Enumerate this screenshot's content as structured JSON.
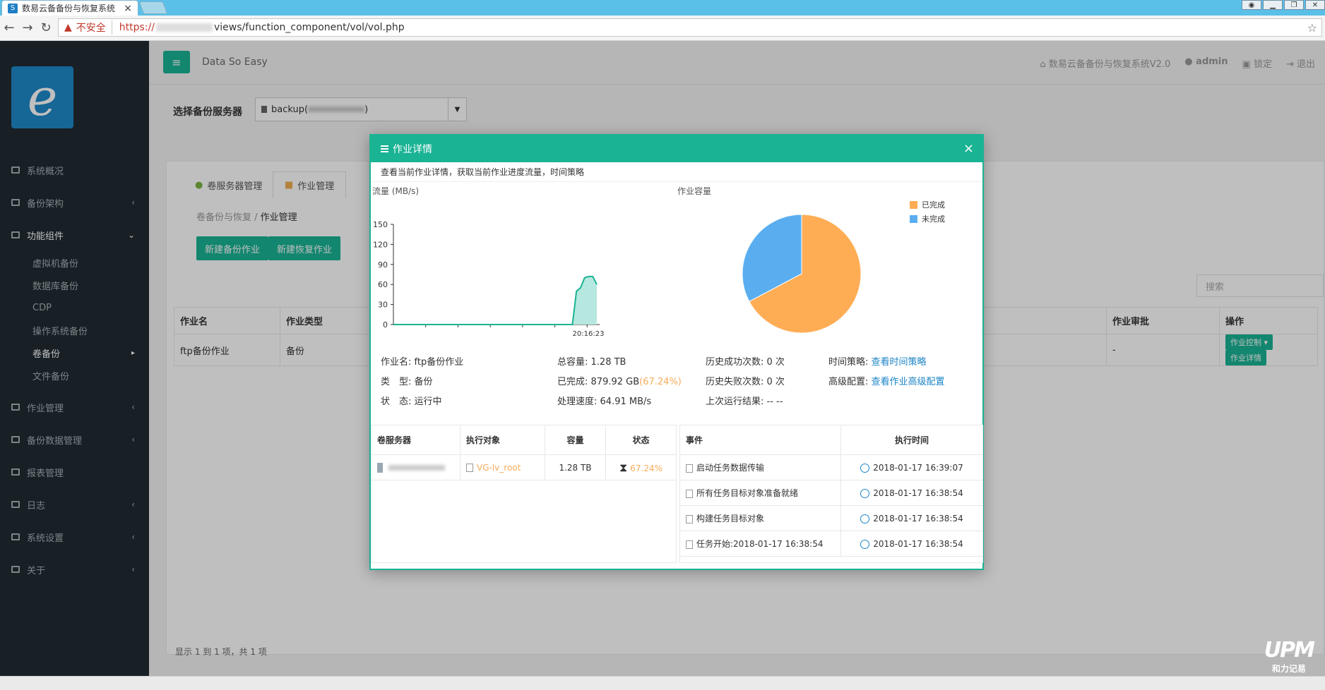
{
  "browser": {
    "tab_title": "数易云备备份与恢复系统",
    "tab_close": "×",
    "insecure_label": "不安全",
    "url_scheme": "https://",
    "url_path": "views/function_component/vol/vol.php"
  },
  "sidebar": {
    "items": [
      {
        "label": "系统概况",
        "chevron": ""
      },
      {
        "label": "备份架构",
        "chevron": "‹"
      },
      {
        "label": "功能组件",
        "chevron": "⌄"
      }
    ],
    "sub_items": [
      {
        "label": "虚拟机备份"
      },
      {
        "label": "数据库备份"
      },
      {
        "label": "CDP"
      },
      {
        "label": "操作系统备份"
      },
      {
        "label": "卷备份",
        "chevron": "▸"
      },
      {
        "label": "文件备份"
      }
    ],
    "items_after": [
      {
        "label": "作业管理",
        "chevron": "‹"
      },
      {
        "label": "备份数据管理",
        "chevron": "‹"
      },
      {
        "label": "报表管理",
        "chevron": ""
      },
      {
        "label": "日志",
        "chevron": "‹"
      },
      {
        "label": "系统设置",
        "chevron": "‹"
      },
      {
        "label": "关于",
        "chevron": "‹"
      }
    ]
  },
  "header": {
    "brand": "Data So Easy",
    "system_name": "数易云备备份与恢复系统V2.0",
    "user": "admin",
    "lock": "锁定",
    "logout": "退出"
  },
  "main": {
    "select_label": "选择备份服务器",
    "select_value": "backup(",
    "select_value_end": ")",
    "tabs": [
      "卷服务器管理",
      "作业管理"
    ],
    "breadcrumb": {
      "parent": "卷备份与恢复 /",
      "current": "作业管理"
    },
    "buttons": [
      "新建备份作业",
      "新建恢复作业"
    ],
    "search_placeholder": "搜索",
    "table": {
      "headers": [
        "作业名",
        "作业类型",
        "",
        "作业审批",
        "操作"
      ],
      "row": {
        "name": "ftp备份作业",
        "type": "备份",
        "approval": "-",
        "btn_control": "作业控制 ▾",
        "btn_detail": "作业详情"
      }
    },
    "footer": "显示 1 到 1 项，共 1 项"
  },
  "modal": {
    "title": "作业详情",
    "close": "×",
    "subtitle": "查看当前作业详情，获取当前作业进度流量，时间策略",
    "flow_label": "流量 (MB/s)",
    "capacity_label": "作业容量",
    "info": {
      "job_name_k": "作业名:",
      "job_name_v": "ftp备份作业",
      "type_k": "类　型:",
      "type_v": "备份",
      "status_k": "状　态:",
      "status_v": "运行中",
      "total_k": "总容量:",
      "total_v": "1.28 TB",
      "done_k": "已完成:",
      "done_v": "879.92 GB",
      "done_pct": "(67.24%)",
      "speed_k": "处理速度:",
      "speed_v": "64.91 MB/s",
      "succ_k": "历史成功次数:",
      "succ_v": "0 次",
      "fail_k": "历史失败次数:",
      "fail_v": "0 次",
      "last_k": "上次运行结果:",
      "last_v": "-- --",
      "policy_k": "时间策略:",
      "policy_v": "查看时间策略",
      "adv_k": "高级配置:",
      "adv_v": "查看作业高级配置"
    },
    "left_table": {
      "headers": [
        "卷服务器",
        "执行对象",
        "容量",
        "状态"
      ],
      "row": {
        "object": "VG-lv_root",
        "capacity": "1.28 TB",
        "status": "67.24%"
      }
    },
    "right_table": {
      "headers": [
        "事件",
        "执行时间"
      ],
      "rows": [
        {
          "event": "启动任务数据传输",
          "time": "2018-01-17 16:39:07"
        },
        {
          "event": "所有任务目标对象准备就绪",
          "time": "2018-01-17 16:38:54"
        },
        {
          "event": "构建任务目标对象",
          "time": "2018-01-17 16:38:54"
        },
        {
          "event": "任务开始:2018-01-17 16:38:54",
          "time": "2018-01-17 16:38:54"
        }
      ]
    }
  },
  "watermark": {
    "logo": "UPM",
    "text": "和力记易"
  },
  "colors": {
    "accent": "#1ab394",
    "sidebar": "#202b33",
    "orange": "#f8ac59",
    "blue": "#5aaef0",
    "link": "#1c84c6"
  },
  "chart_data": [
    {
      "type": "area",
      "ylabel": "流量 (MB/s)",
      "ylim": [
        0,
        150
      ],
      "yticks": [
        0,
        30,
        60,
        90,
        120,
        150
      ],
      "x_tick_label": "20:16:23",
      "values": [
        0,
        0,
        0,
        0,
        0,
        0,
        0,
        0,
        0,
        0,
        0,
        0,
        0,
        0,
        0,
        0,
        0,
        0,
        0,
        0,
        0,
        0,
        0,
        0,
        0,
        0,
        0,
        0,
        0,
        0,
        0,
        0,
        0,
        0,
        0,
        0,
        0,
        0,
        0,
        0,
        0,
        0,
        0,
        0,
        0,
        50,
        55,
        70,
        72,
        72,
        60
      ]
    },
    {
      "type": "pie",
      "title": "作业容量",
      "series": [
        {
          "name": "已完成",
          "value": 67.24,
          "color": "#ffad55"
        },
        {
          "name": "未完成",
          "value": 32.76,
          "color": "#5aaef0"
        }
      ],
      "legend": "top-right"
    }
  ]
}
